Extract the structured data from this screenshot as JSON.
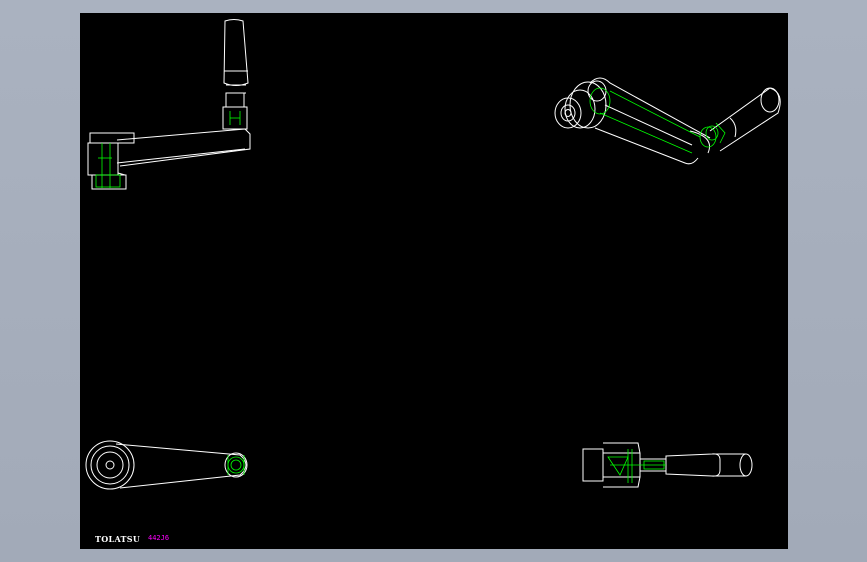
{
  "drawing": {
    "brand_label": "TOLATSU",
    "part_number": "442J6"
  },
  "colors": {
    "background": "#a6aebc",
    "canvas": "#000000",
    "outline": "#ffffff",
    "hidden_lines": "#00ff00",
    "part_number": "#ff00ff"
  },
  "views": [
    {
      "name": "front-view"
    },
    {
      "name": "isometric-view"
    },
    {
      "name": "top-view"
    },
    {
      "name": "side-view"
    }
  ]
}
